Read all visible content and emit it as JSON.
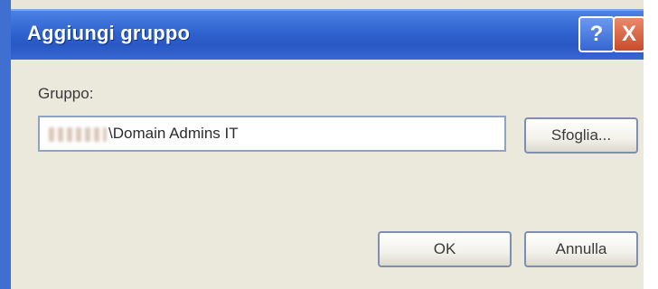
{
  "window": {
    "title": "Aggiungi gruppo",
    "help_glyph": "?",
    "close_glyph": "X"
  },
  "form": {
    "group_label": "Gruppo:",
    "group_value": "\\Domain Admins IT",
    "browse_label": "Sfoglia..."
  },
  "footer": {
    "ok_label": "OK",
    "cancel_label": "Annulla"
  },
  "colors": {
    "titlebar": "#2f63cf",
    "dialog_bg": "#ebe8dc",
    "button_border": "#7f8eb0"
  },
  "icons": {
    "help": "help-icon",
    "close": "close-icon"
  }
}
